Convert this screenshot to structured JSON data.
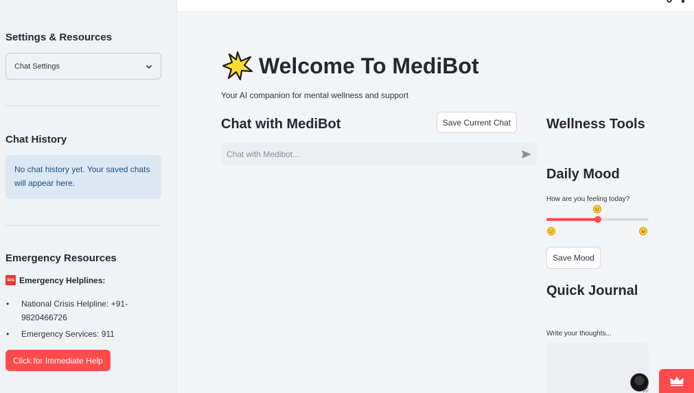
{
  "sidebar": {
    "settings_heading": "Settings & Resources",
    "chat_settings_select": "Chat Settings",
    "history_heading": "Chat History",
    "history_info": "No chat history yet. Your saved chats will appear here.",
    "emergency_heading": "Emergency Resources",
    "helplines_label": "Emergency Helplines:",
    "sos_icon_text": "SOS",
    "helplines": [
      "National Crisis Helpline: +91-9820466726",
      "Emergency Services: 911"
    ],
    "help_button": "Click for Immediate Help"
  },
  "main": {
    "title": "Welcome To MediBot",
    "subtitle": "Your AI companion for mental wellness and support",
    "chat_heading": "Chat with MediBot",
    "save_chat_button": "Save Current Chat",
    "chat_placeholder": "Chat with Medibot...",
    "wellness_heading": "Wellness Tools",
    "mood_heading": "Daily Mood",
    "mood_question": "How are you feeling today?",
    "mood_value_fraction": 0.5,
    "save_mood_button": "Save Mood",
    "journal_heading": "Quick Journal",
    "journal_label": "Write your thoughts..."
  },
  "colors": {
    "accent": "#ff4b4b",
    "sidebar_bg": "#f0f2f6",
    "info_bg": "#dce8f4",
    "info_text": "#1e4e79"
  },
  "icons": [
    "star-icon",
    "chevron-down-icon",
    "send-icon",
    "sos-icon",
    "crown-icon",
    "neutral-face-icon",
    "sad-face-icon",
    "happy-face-icon"
  ]
}
